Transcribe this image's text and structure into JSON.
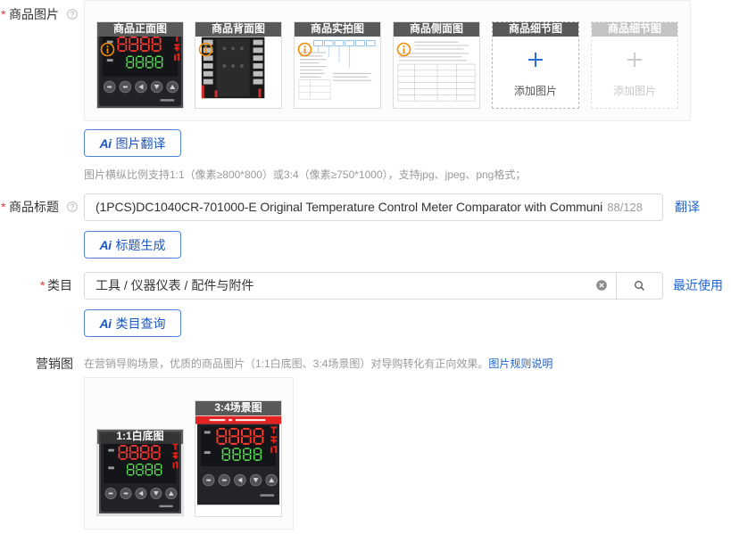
{
  "product_images": {
    "required_mark": "*",
    "label": "商品图片",
    "slots": [
      {
        "title": "商品正面图",
        "has_warning": true
      },
      {
        "title": "商品背面图",
        "has_warning": true
      },
      {
        "title": "商品实拍图",
        "has_warning": true
      },
      {
        "title": "商品侧面图",
        "has_warning": true
      },
      {
        "title": "商品细节图",
        "add_label": "添加图片"
      },
      {
        "title": "商品细节图",
        "add_label": "添加图片"
      }
    ],
    "translate_button": {
      "ai_badge": "Ai",
      "label": "图片翻译"
    },
    "hint": "图片横纵比例支持1:1（像素≥800*800）或3:4（像素≥750*1000），支持jpg、jpeg、png格式；"
  },
  "product_title": {
    "required_mark": "*",
    "label": "商品标题",
    "value": "(1PCS)DC1040CR-701000-E Original Temperature Control Meter Comparator with Communi",
    "counter": "88/128",
    "translate_link": "翻译",
    "generate_button": {
      "ai_badge": "Ai",
      "label": "标题生成"
    }
  },
  "category": {
    "required_mark": "*",
    "label": "类目",
    "value": "工具 / 仪器仪表 / 配件与附件",
    "recent_link": "最近使用",
    "query_button": {
      "ai_badge": "Ai",
      "label": "类目查询"
    }
  },
  "marketing_images": {
    "label": "营销图",
    "hint": "在营销导购场景，优质的商品图片（1:1白底图、3:4场景图）对导购转化有正向效果。",
    "rules_link": "图片规则说明",
    "slots": [
      {
        "title": "1:1白底图"
      },
      {
        "title": "3:4场景图"
      }
    ]
  },
  "icons": {
    "help": "question-circle-icon",
    "image_warning": "info-circle-icon",
    "add_image": "plus-icon",
    "clear": "close-circle-icon",
    "search": "search-icon",
    "ai": "ai-icon"
  },
  "colors": {
    "accent": "#1e64d2",
    "required": "#e53935",
    "warning": "#f08c00",
    "slot_header": "#595959",
    "slot_header_disabled": "#c4c4c4",
    "hint_text": "#9a9a9a",
    "border": "#d9d9d9"
  }
}
